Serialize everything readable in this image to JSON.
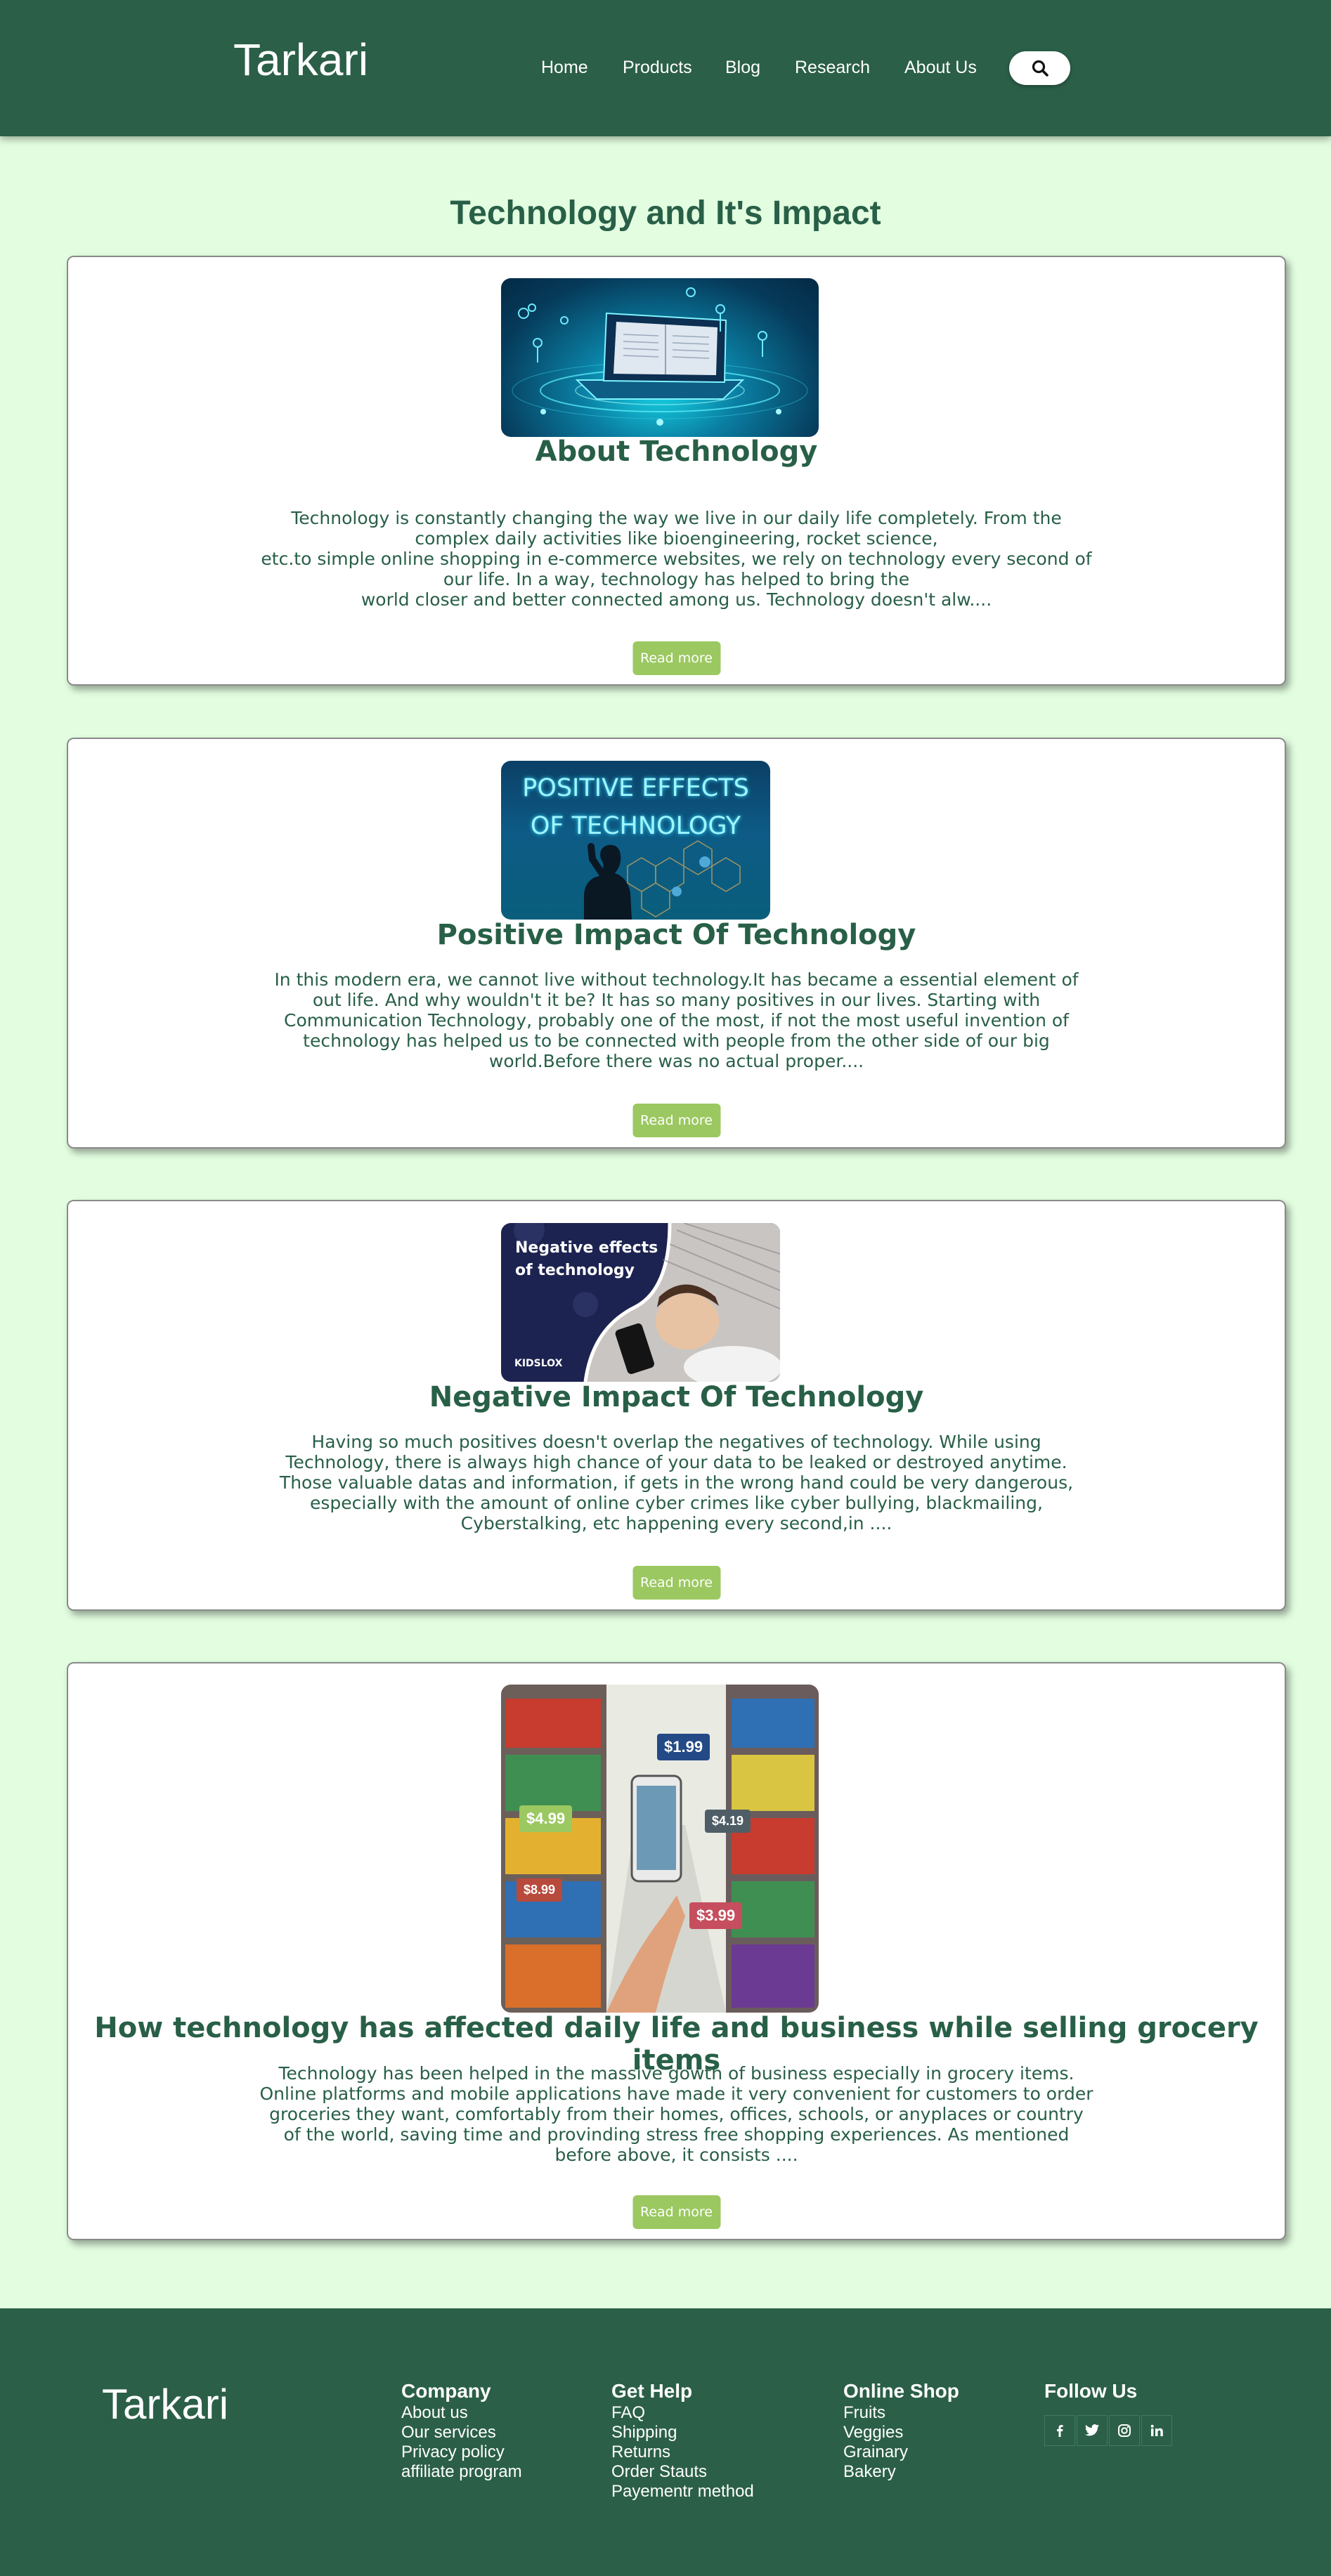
{
  "header": {
    "logo": "Tarkari",
    "nav": [
      "Home",
      "Products",
      "Blog",
      "Research",
      "About Us"
    ],
    "search_icon": "search-icon"
  },
  "page_title": "Technology and It's Impact",
  "cards": [
    {
      "title": "About Technology",
      "image_icon": "laptop-book-illustration",
      "text": [
        "Technology is constantly changing the way we live in our daily life completely. From the complex daily activities like bioengineering, rocket science,",
        "etc.to simple online shopping in e-commerce websites, we rely on technology every second of our life. In a way, technology has helped to bring the",
        "world closer and better connected among us. Technology doesn't alw...."
      ],
      "button": "Read more"
    },
    {
      "title": "Positive Impact Of Technology",
      "image_text": "POSITIVE EFFECTS OF TECHNOLOGY",
      "text": [
        "In this modern era, we cannot live without technology.It has became a essential element of out life. And why wouldn't it be? It has so many positives in our lives. Starting with Communication Technology, probably one of the most, if not the most useful invention of technology has helped us to be connected with people from the other side of our big world.Before there was no actual proper...."
      ],
      "button": "Read more"
    },
    {
      "title": "Negative Impact Of Technology",
      "image_text": "Negative effects of technology",
      "image_brand": "KIDSLOX",
      "text": [
        "Having so much positives doesn't overlap the negatives of technology. While using Technology, there is always high chance of your data to be leaked or destroyed anytime. Those valuable datas and information, if gets in the wrong hand could be very dangerous, especially with the amount of online cyber crimes like cyber bullying, blackmailing, Cyberstalking, etc happening every second,in ...."
      ],
      "button": "Read more"
    },
    {
      "title": "How technology has affected daily life and business while selling grocery items",
      "image_prices": [
        "$1.99",
        "$4.99",
        "$4.19",
        "$8.99",
        "$3.99"
      ],
      "text": [
        "Technology has been helped in the massive gowth of business especially in grocery items. Online platforms and mobile applications have made it very convenient for customers to order groceries they want, comfortably from their homes, offices, schools, or anyplaces or country of the world, saving time and provinding stress free shopping experiences. As mentioned before above, it consists ...."
      ],
      "button": "Read more"
    }
  ],
  "footer": {
    "logo": "Tarkari",
    "columns": [
      {
        "title": "Company",
        "items": [
          "About us",
          "Our services",
          "Privacy policy",
          "affiliate program"
        ]
      },
      {
        "title": "Get Help",
        "items": [
          "FAQ",
          "Shipping",
          "Returns",
          "Order Stauts",
          "Payementr method"
        ]
      },
      {
        "title": "Online Shop",
        "items": [
          "Fruits",
          "Veggies",
          "Grainary",
          "Bakery"
        ]
      },
      {
        "title": "Follow Us",
        "items": []
      }
    ],
    "social_icons": [
      "facebook-icon",
      "twitter-icon",
      "instagram-icon",
      "linkedin-icon"
    ]
  },
  "colors": {
    "header_bg": "#2b5f48",
    "page_bg": "#e2fde0",
    "title_text": "#285f47",
    "button_bg": "#9bc860"
  }
}
